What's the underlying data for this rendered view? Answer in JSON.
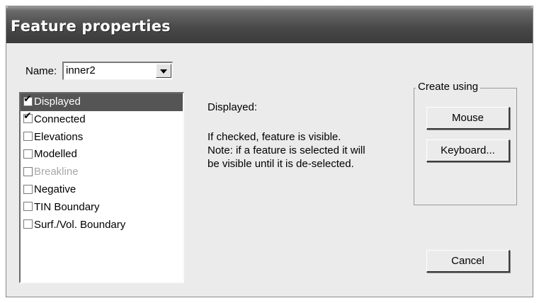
{
  "window": {
    "title": "Feature properties"
  },
  "name_field": {
    "label": "Name:",
    "value": "inner2"
  },
  "features": [
    {
      "label": "Displayed",
      "checked": true,
      "selected": true,
      "enabled": true
    },
    {
      "label": "Connected",
      "checked": true,
      "selected": false,
      "enabled": true
    },
    {
      "label": "Elevations",
      "checked": false,
      "selected": false,
      "enabled": true
    },
    {
      "label": "Modelled",
      "checked": false,
      "selected": false,
      "enabled": true
    },
    {
      "label": "Breakline",
      "checked": false,
      "selected": false,
      "enabled": false
    },
    {
      "label": "Negative",
      "checked": false,
      "selected": false,
      "enabled": true
    },
    {
      "label": "TIN Boundary",
      "checked": false,
      "selected": false,
      "enabled": true
    },
    {
      "label": "Surf./Vol. Boundary",
      "checked": false,
      "selected": false,
      "enabled": true
    }
  ],
  "description": {
    "heading": "Displayed:",
    "lines": [
      "If checked, feature is visible.",
      "Note: if a feature is selected it will",
      "be visible until it is de-selected."
    ]
  },
  "create_using": {
    "legend": "Create using",
    "mouse_label": "Mouse",
    "keyboard_label": "Keyboard..."
  },
  "cancel_label": "Cancel",
  "colors": {
    "dialog_bg": "#ebebeb",
    "titlebar": "#4a4a4a",
    "selection": "#555555",
    "disabled_text": "#a8a8a8"
  }
}
